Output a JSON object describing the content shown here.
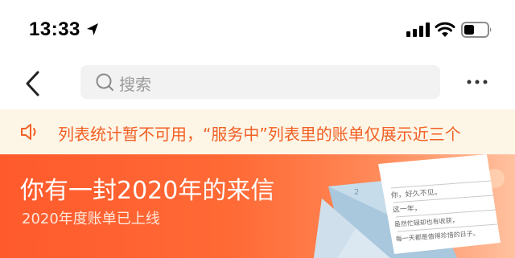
{
  "status_bar": {
    "time": "13:33",
    "location_icon": "location-arrow-icon",
    "signal_icon": "cellular-signal-icon",
    "wifi_icon": "wifi-icon",
    "battery_icon": "battery-icon"
  },
  "nav": {
    "back_icon": "chevron-left-icon",
    "search_placeholder": "搜索",
    "more_icon": "ellipsis-icon"
  },
  "notice": {
    "icon": "speaker-icon",
    "text": "列表统计暂不可用，“服务中”列表里的账单仅展示近三个"
  },
  "banner": {
    "title": "你有一封2020年的来信",
    "subtitle": "2020年度账单已上线",
    "letter_lines": [
      "你，好久不见。",
      "这一年，",
      "虽然忙碌却也有收获，",
      "每一天都是值得珍惜的日子。"
    ],
    "envelope_number": "2",
    "colors": {
      "gradient_start": "#ff5a2c",
      "gradient_end": "#ffb48d"
    }
  },
  "colors": {
    "notice_text": "#f25f23",
    "notice_bg": "#fdf6e7",
    "search_bg": "#f2f2f2"
  }
}
